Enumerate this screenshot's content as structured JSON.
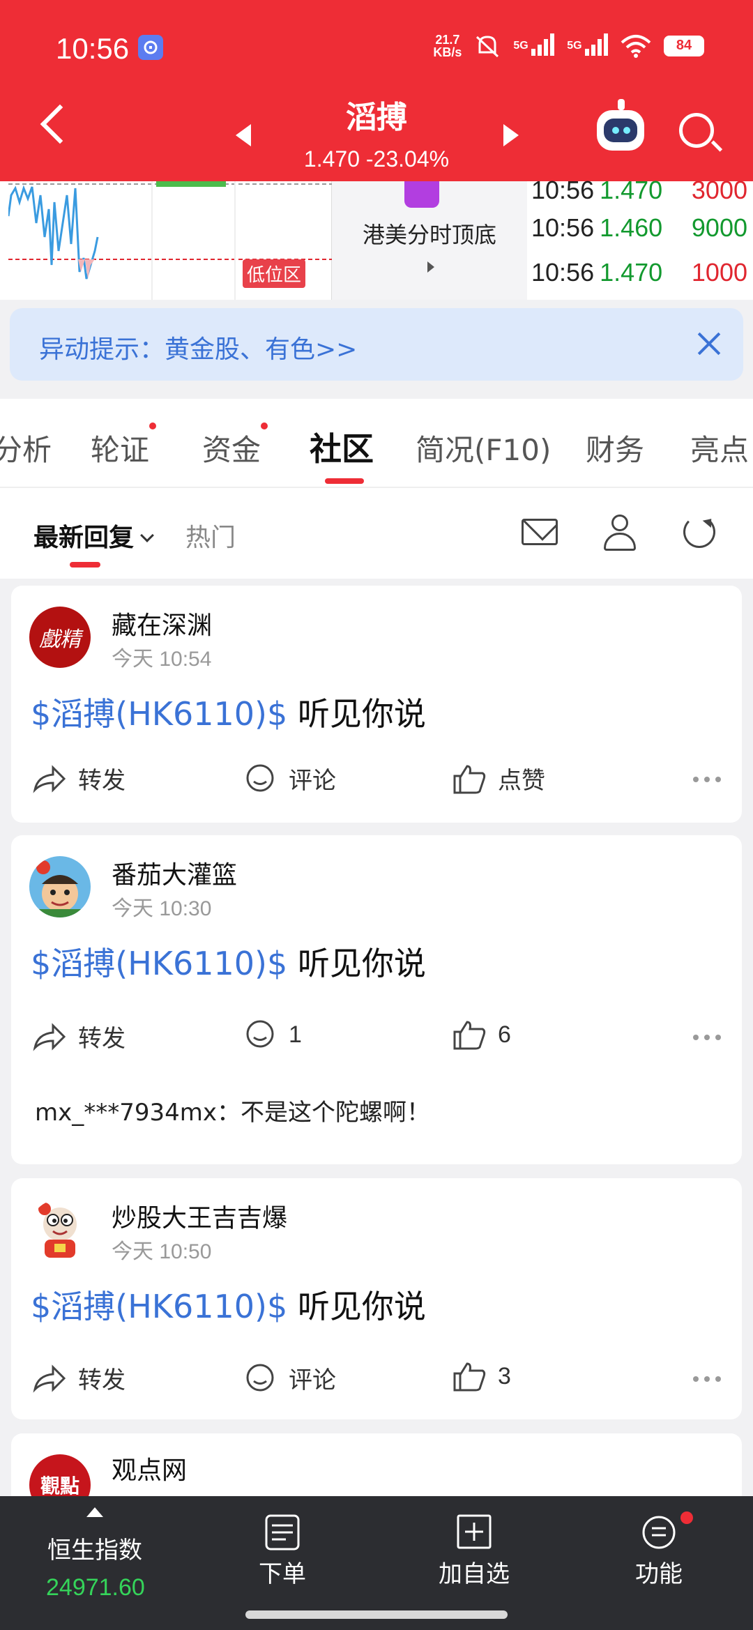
{
  "statusbar": {
    "time": "10:56",
    "net_speed_top": "21.7",
    "net_speed_bottom": "KB/s",
    "sim1": "5G",
    "sim2": "5G",
    "wifi_sub": "6",
    "battery": "84"
  },
  "header": {
    "stock_name": "滔搏",
    "price_line": "1.470 -23.04%",
    "colors": {
      "bg": "#ee2d36"
    }
  },
  "chart_strip": {
    "low_tag": "低位区",
    "mid_label": "港美分时顶底",
    "ticks": [
      {
        "time": "10:56",
        "price": "1.470",
        "volume": "3000",
        "vol_color": "red"
      },
      {
        "time": "10:56",
        "price": "1.460",
        "volume": "9000",
        "vol_color": "green"
      },
      {
        "time": "10:56",
        "price": "1.470",
        "volume": "1000",
        "vol_color": "red"
      }
    ]
  },
  "alert": {
    "text": "异动提示：黄金股、有色>>"
  },
  "tabs": [
    {
      "label": "分析"
    },
    {
      "label": "轮证",
      "dot": true
    },
    {
      "label": "资金",
      "dot": true
    },
    {
      "label": "社区",
      "active": true
    },
    {
      "label": "简况(F10)"
    },
    {
      "label": "财务"
    },
    {
      "label": "亮点"
    }
  ],
  "subhead": {
    "latest": "最新回复",
    "hot": "热门"
  },
  "posts": [
    {
      "author": "藏在深渊",
      "time": "今天 10:54",
      "stock_link": "$滔搏(HK6110)$",
      "text": " 听见你说",
      "repost": "转发",
      "comment": "评论",
      "like": "点赞"
    },
    {
      "author": "番茄大灌篮",
      "time": "今天 10:30",
      "stock_link": "$滔搏(HK6110)$",
      "text": " 听见你说",
      "repost": "转发",
      "comment": "1",
      "like": "6",
      "reply": "mx_***7934mx：不是这个陀螺啊！"
    },
    {
      "author": "炒股大王吉吉爆",
      "time": "今天 10:50",
      "stock_link": "$滔搏(HK6110)$",
      "text": " 听见你说",
      "repost": "转发",
      "comment": "评论",
      "like": "3"
    },
    {
      "author": "观点网"
    }
  ],
  "avatar_texts": {
    "post1": "戲精",
    "post4": "觀點"
  },
  "bottom_nav": {
    "index_name": "恒生指数",
    "index_value": "24971.60",
    "order": "下单",
    "add_watch": "加自选",
    "functions": "功能"
  }
}
